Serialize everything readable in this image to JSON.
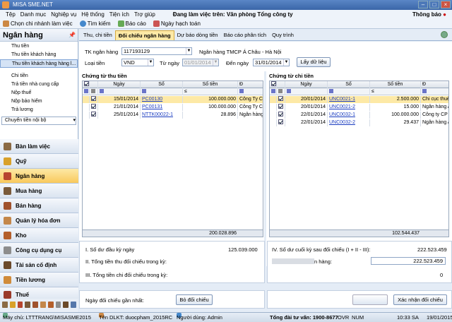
{
  "app": {
    "title": "MISA SME.NET"
  },
  "menu": {
    "items": [
      "Tệp",
      "Danh mục",
      "Nghiệp vụ",
      "Hệ thống",
      "Tiện ích",
      "Trợ giúp"
    ],
    "workplace": "Đang làm việc trên: Văn phòng Tổng công ty",
    "notify": "Thông báo"
  },
  "toolbar": {
    "items": [
      "Chọn chi nhánh làm việc",
      "Tìm kiếm",
      "Báo cáo",
      "Ngày hạch toán"
    ]
  },
  "sidebar": {
    "title": "Ngân hàng",
    "items": [
      "Thu tiền",
      "Thu tiền khách hàng",
      "Thu tiền khách hàng hàng l...",
      "Chi tiền",
      "Trả tiền nhà cung cấp",
      "Nộp thuế",
      "Nộp bảo hiểm",
      "Trả lương"
    ],
    "dropdown": "Chuyển tiền nội bộ",
    "modules": [
      "Bàn làm việc",
      "Quỹ",
      "Ngân hàng",
      "Mua hàng",
      "Bán hàng",
      "Quản lý hóa đơn",
      "Kho",
      "Công cụ dụng cụ",
      "Tài sản cố định",
      "Tiền lương",
      "Thuế"
    ]
  },
  "tabs": [
    "Thu, chi tiền",
    "Đối chiếu ngân hàng",
    "Dự báo dòng tiền",
    "Báo cáo phân tích",
    "Quy trình"
  ],
  "filters": {
    "account_label": "TK ngân hàng",
    "account_value": "117193129",
    "bank_name": "Ngân hàng TMCP Á Châu - Hà Nội",
    "currency_label": "Loại tiền",
    "currency_value": "VND",
    "from_label": "Từ ngày",
    "from_value": "01/01/2014",
    "to_label": "Đến ngày",
    "to_value": "31/01/2014",
    "load_button": "Lấy dữ liệu"
  },
  "receipts": {
    "title": "Chứng từ thu tiền",
    "columns": [
      "Ngày",
      "Số",
      "Số tiền",
      "Đ"
    ],
    "rows": [
      {
        "date": "15/01/2014",
        "no": "PC00130",
        "amount": "100.000.000",
        "desc": "Công Ty Cổ Ph"
      },
      {
        "date": "21/01/2014",
        "no": "PC00131",
        "amount": "100.000.000",
        "desc": "Công Ty Cổ Ph"
      },
      {
        "date": "25/01/2014",
        "no": "NTTK00022-1",
        "amount": "28.896",
        "desc": "Ngân hàng A"
      }
    ],
    "total": "200.028.896"
  },
  "payments": {
    "title": "Chứng từ chi tiền",
    "columns": [
      "Ngày",
      "Số",
      "Số tiền",
      "Đ"
    ],
    "rows": [
      {
        "date": "20/01/2014",
        "no": "UNC0021-1",
        "amount": "2.500.000",
        "desc": "Chi cục thuế"
      },
      {
        "date": "20/01/2014",
        "no": "UNC0021-2",
        "amount": "15.000",
        "desc": "Ngân hàng A"
      },
      {
        "date": "22/01/2014",
        "no": "UNC0032-1",
        "amount": "100.000.000",
        "desc": "Công ty CP D"
      },
      {
        "date": "22/01/2014",
        "no": "UNC0032-2",
        "amount": "29.437",
        "desc": "Ngân hàng A"
      }
    ],
    "total": "102.544.437"
  },
  "summary": {
    "l1": "I. Số dư đầu kỳ ngày",
    "v1": "125.039.000",
    "l2": "II. Tổng tiền thu đối chiếu trong kỳ:",
    "l3": "III. Tổng tiền chi đối chiếu trong kỳ:",
    "r1": "IV. Số dư cuối kỳ sau đối chiếu (I + II - III):",
    "rv1": "222.523.459",
    "r2": "n hàng:",
    "rv2": "222.523.459",
    "rv3": "0"
  },
  "bottom": {
    "last_label": "Ngày đối chiếu gần nhất:",
    "undo": "Bỏ đối chiếu",
    "confirm": "Xác nhận đối chiếu"
  },
  "status": {
    "host": "Máy chủ: LTTTRANG\\MISASME2015",
    "db": "Tên DLKT: duocpham_2015RC",
    "user": "Người dùng: Admin",
    "hotline": "Tổng đài tư vấn: 1900-8677",
    "ovr": "OVR",
    "num": "NUM",
    "time": "10:33 SA",
    "date": "19/01/2015"
  },
  "colors": {
    "accent": "#fde9a6",
    "link": "#1a3cc0",
    "title": "#3a66a8"
  }
}
